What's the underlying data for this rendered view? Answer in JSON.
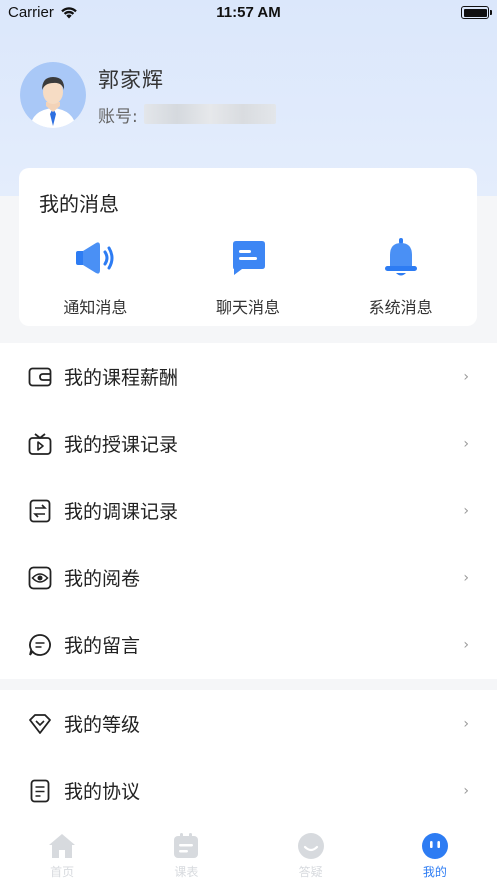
{
  "status_bar": {
    "carrier": "Carrier",
    "time": "11:57 AM"
  },
  "profile": {
    "name": "郭家辉",
    "account_label": "账号:",
    "account_value": ""
  },
  "messages": {
    "title": "我的消息",
    "items": [
      {
        "label": "通知消息",
        "icon": "speaker-icon"
      },
      {
        "label": "聊天消息",
        "icon": "chat-icon"
      },
      {
        "label": "系统消息",
        "icon": "bell-icon"
      }
    ]
  },
  "menu": {
    "group1": [
      {
        "label": "我的课程薪酬",
        "icon": "wallet-icon"
      },
      {
        "label": "我的授课记录",
        "icon": "tv-icon"
      },
      {
        "label": "我的调课记录",
        "icon": "swap-icon"
      },
      {
        "label": "我的阅卷",
        "icon": "eye-icon"
      },
      {
        "label": "我的留言",
        "icon": "message-icon"
      }
    ],
    "group2": [
      {
        "label": "我的等级",
        "icon": "diamond-icon"
      },
      {
        "label": "我的协议",
        "icon": "document-icon"
      }
    ],
    "chevron": "›"
  },
  "tabbar": {
    "tabs": [
      {
        "label": "首页",
        "icon": "home-icon"
      },
      {
        "label": "课表",
        "icon": "calendar-icon"
      },
      {
        "label": "答疑",
        "icon": "face-icon"
      },
      {
        "label": "我的",
        "icon": "profile-face-icon"
      }
    ],
    "active_index": 3
  },
  "colors": {
    "accent": "#2d7cf3",
    "header_bg": "#dbe7fb",
    "inactive_tab": "#d7dade"
  }
}
